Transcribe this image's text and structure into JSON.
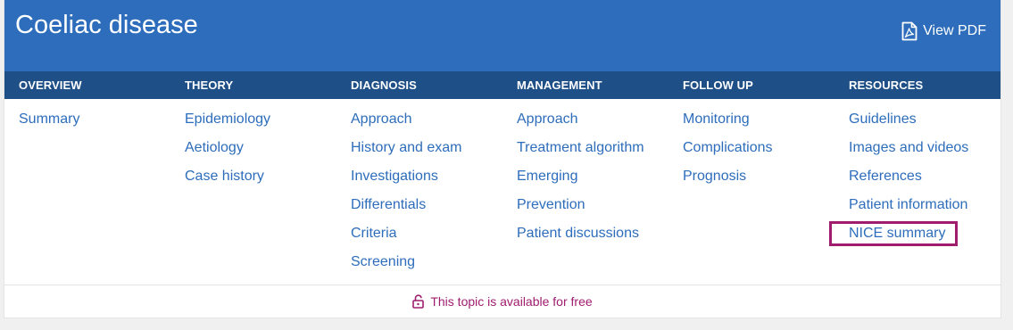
{
  "header": {
    "title": "Coeliac disease",
    "view_pdf_label": "View PDF",
    "background_color": "#2d6dbb",
    "pdf_icon": "pdf-file-icon"
  },
  "tabs": {
    "bar_color": "#1e4f87",
    "items": [
      {
        "label": "OVERVIEW"
      },
      {
        "label": "THEORY"
      },
      {
        "label": "DIAGNOSIS"
      },
      {
        "label": "MANAGEMENT"
      },
      {
        "label": "FOLLOW UP"
      },
      {
        "label": "RESOURCES"
      }
    ]
  },
  "columns": [
    {
      "links": [
        "Summary"
      ]
    },
    {
      "links": [
        "Epidemiology",
        "Aetiology",
        "Case history"
      ]
    },
    {
      "links": [
        "Approach",
        "History and exam",
        "Investigations",
        "Differentials",
        "Criteria",
        "Screening"
      ]
    },
    {
      "links": [
        "Approach",
        "Treatment algorithm",
        "Emerging",
        "Prevention",
        "Patient discussions"
      ]
    },
    {
      "links": [
        "Monitoring",
        "Complications",
        "Prognosis"
      ]
    },
    {
      "links": [
        "Guidelines",
        "Images and videos",
        "References",
        "Patient information",
        "NICE summary"
      ]
    }
  ],
  "highlighted_link": "NICE summary",
  "highlight_color": "#a01d6e",
  "link_color": "#2d6dbb",
  "footer": {
    "free_text": "This topic is available for free",
    "icon": "unlocked-padlock-icon",
    "color": "#a01d6e"
  }
}
